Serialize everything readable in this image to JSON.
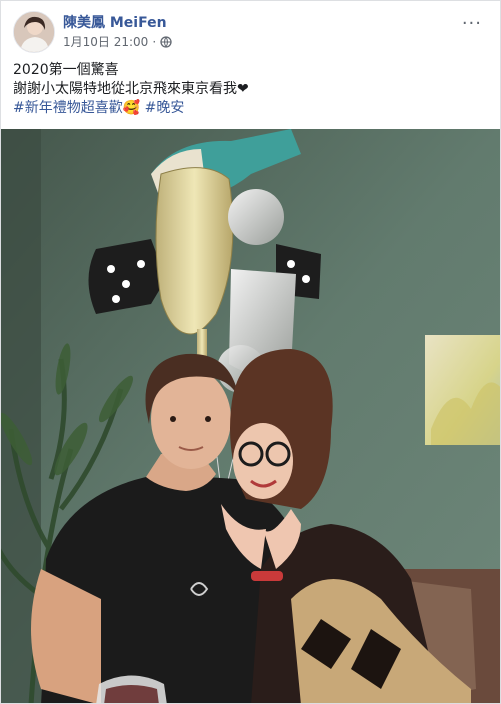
{
  "post": {
    "author": "陳美鳳 MeiFen",
    "timestamp": "1月10日 21:00",
    "separator": "·",
    "audience_icon": "globe-icon",
    "more_icon": "ellipsis-icon",
    "more_label": "···",
    "lines": [
      "2020第一個驚喜",
      "謝謝小太陽特地從北京飛來東京看我❤"
    ],
    "hashtags": [
      "#新年禮物超喜歡🥰",
      "#晚安"
    ]
  },
  "colors": {
    "link": "#385898",
    "text": "#1c1e21",
    "meta": "#616770",
    "wall": "#566f63"
  }
}
